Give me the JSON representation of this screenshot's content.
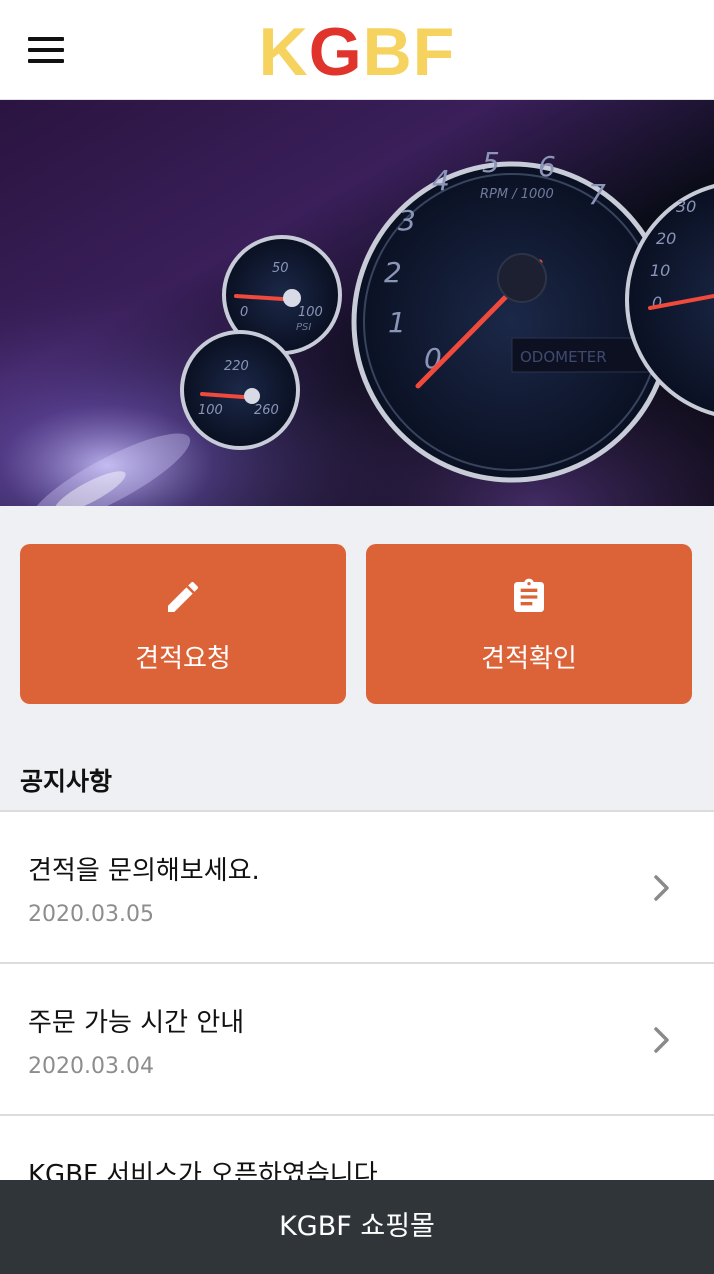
{
  "header": {
    "logo_part1": "K",
    "logo_part2": "G",
    "logo_part3": "BF",
    "menu_icon": "hamburger-menu-icon"
  },
  "hero": {
    "image": "car-dashboard-gauges",
    "gauge_small_top": {
      "tick_50": "50",
      "tick_0": "0",
      "tick_100": "100",
      "unit": "PSI"
    },
    "gauge_small_bottom": {
      "tick_220": "220",
      "tick_100": "100",
      "tick_260": "260"
    },
    "gauge_large": {
      "ticks": [
        "0",
        "1",
        "2",
        "3",
        "4",
        "5",
        "6",
        "7"
      ],
      "unit": "RPM / 1000",
      "odometer": "ODOMETER"
    },
    "gauge_right": {
      "ticks": [
        "30",
        "20",
        "10",
        "0"
      ]
    }
  },
  "actions": {
    "request": {
      "label": "견적요청",
      "icon": "pencil-icon"
    },
    "confirm": {
      "label": "견적확인",
      "icon": "clipboard-icon"
    }
  },
  "notices": {
    "title": "공지사항",
    "items": [
      {
        "title": "견적을 문의해보세요.",
        "date": "2020.03.05"
      },
      {
        "title": "주문 가능 시간 안내",
        "date": "2020.03.04"
      },
      {
        "title": "KGBF 서비스가 오픈하였습니다",
        "date": ""
      }
    ]
  },
  "bottom_bar": {
    "label": "KGBF 쇼핑몰"
  },
  "colors": {
    "accent": "#dc6338",
    "logo_yellow": "#f6d35e",
    "logo_red": "#e0332b",
    "bottom_bar": "#30353a",
    "background": "#eff0f3"
  }
}
